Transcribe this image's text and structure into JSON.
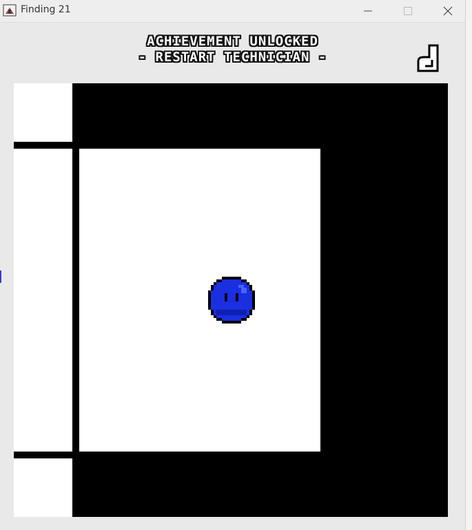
{
  "window": {
    "title": "Finding 21",
    "controls": {
      "minimize": "minimize",
      "maximize": "maximize",
      "close": "close"
    }
  },
  "achievement": {
    "line1": "ACHIEVEMENT UNLOCKED",
    "line2": "- RESTART TECHNICIAN -"
  },
  "icons": {
    "app": "java-app-icon",
    "corner": "boot-icon",
    "player": "blue-blob-character"
  },
  "colors": {
    "wall": "#000000",
    "floor": "#ffffff",
    "player": "#1a2fe0",
    "background": "#e9e9e9"
  }
}
